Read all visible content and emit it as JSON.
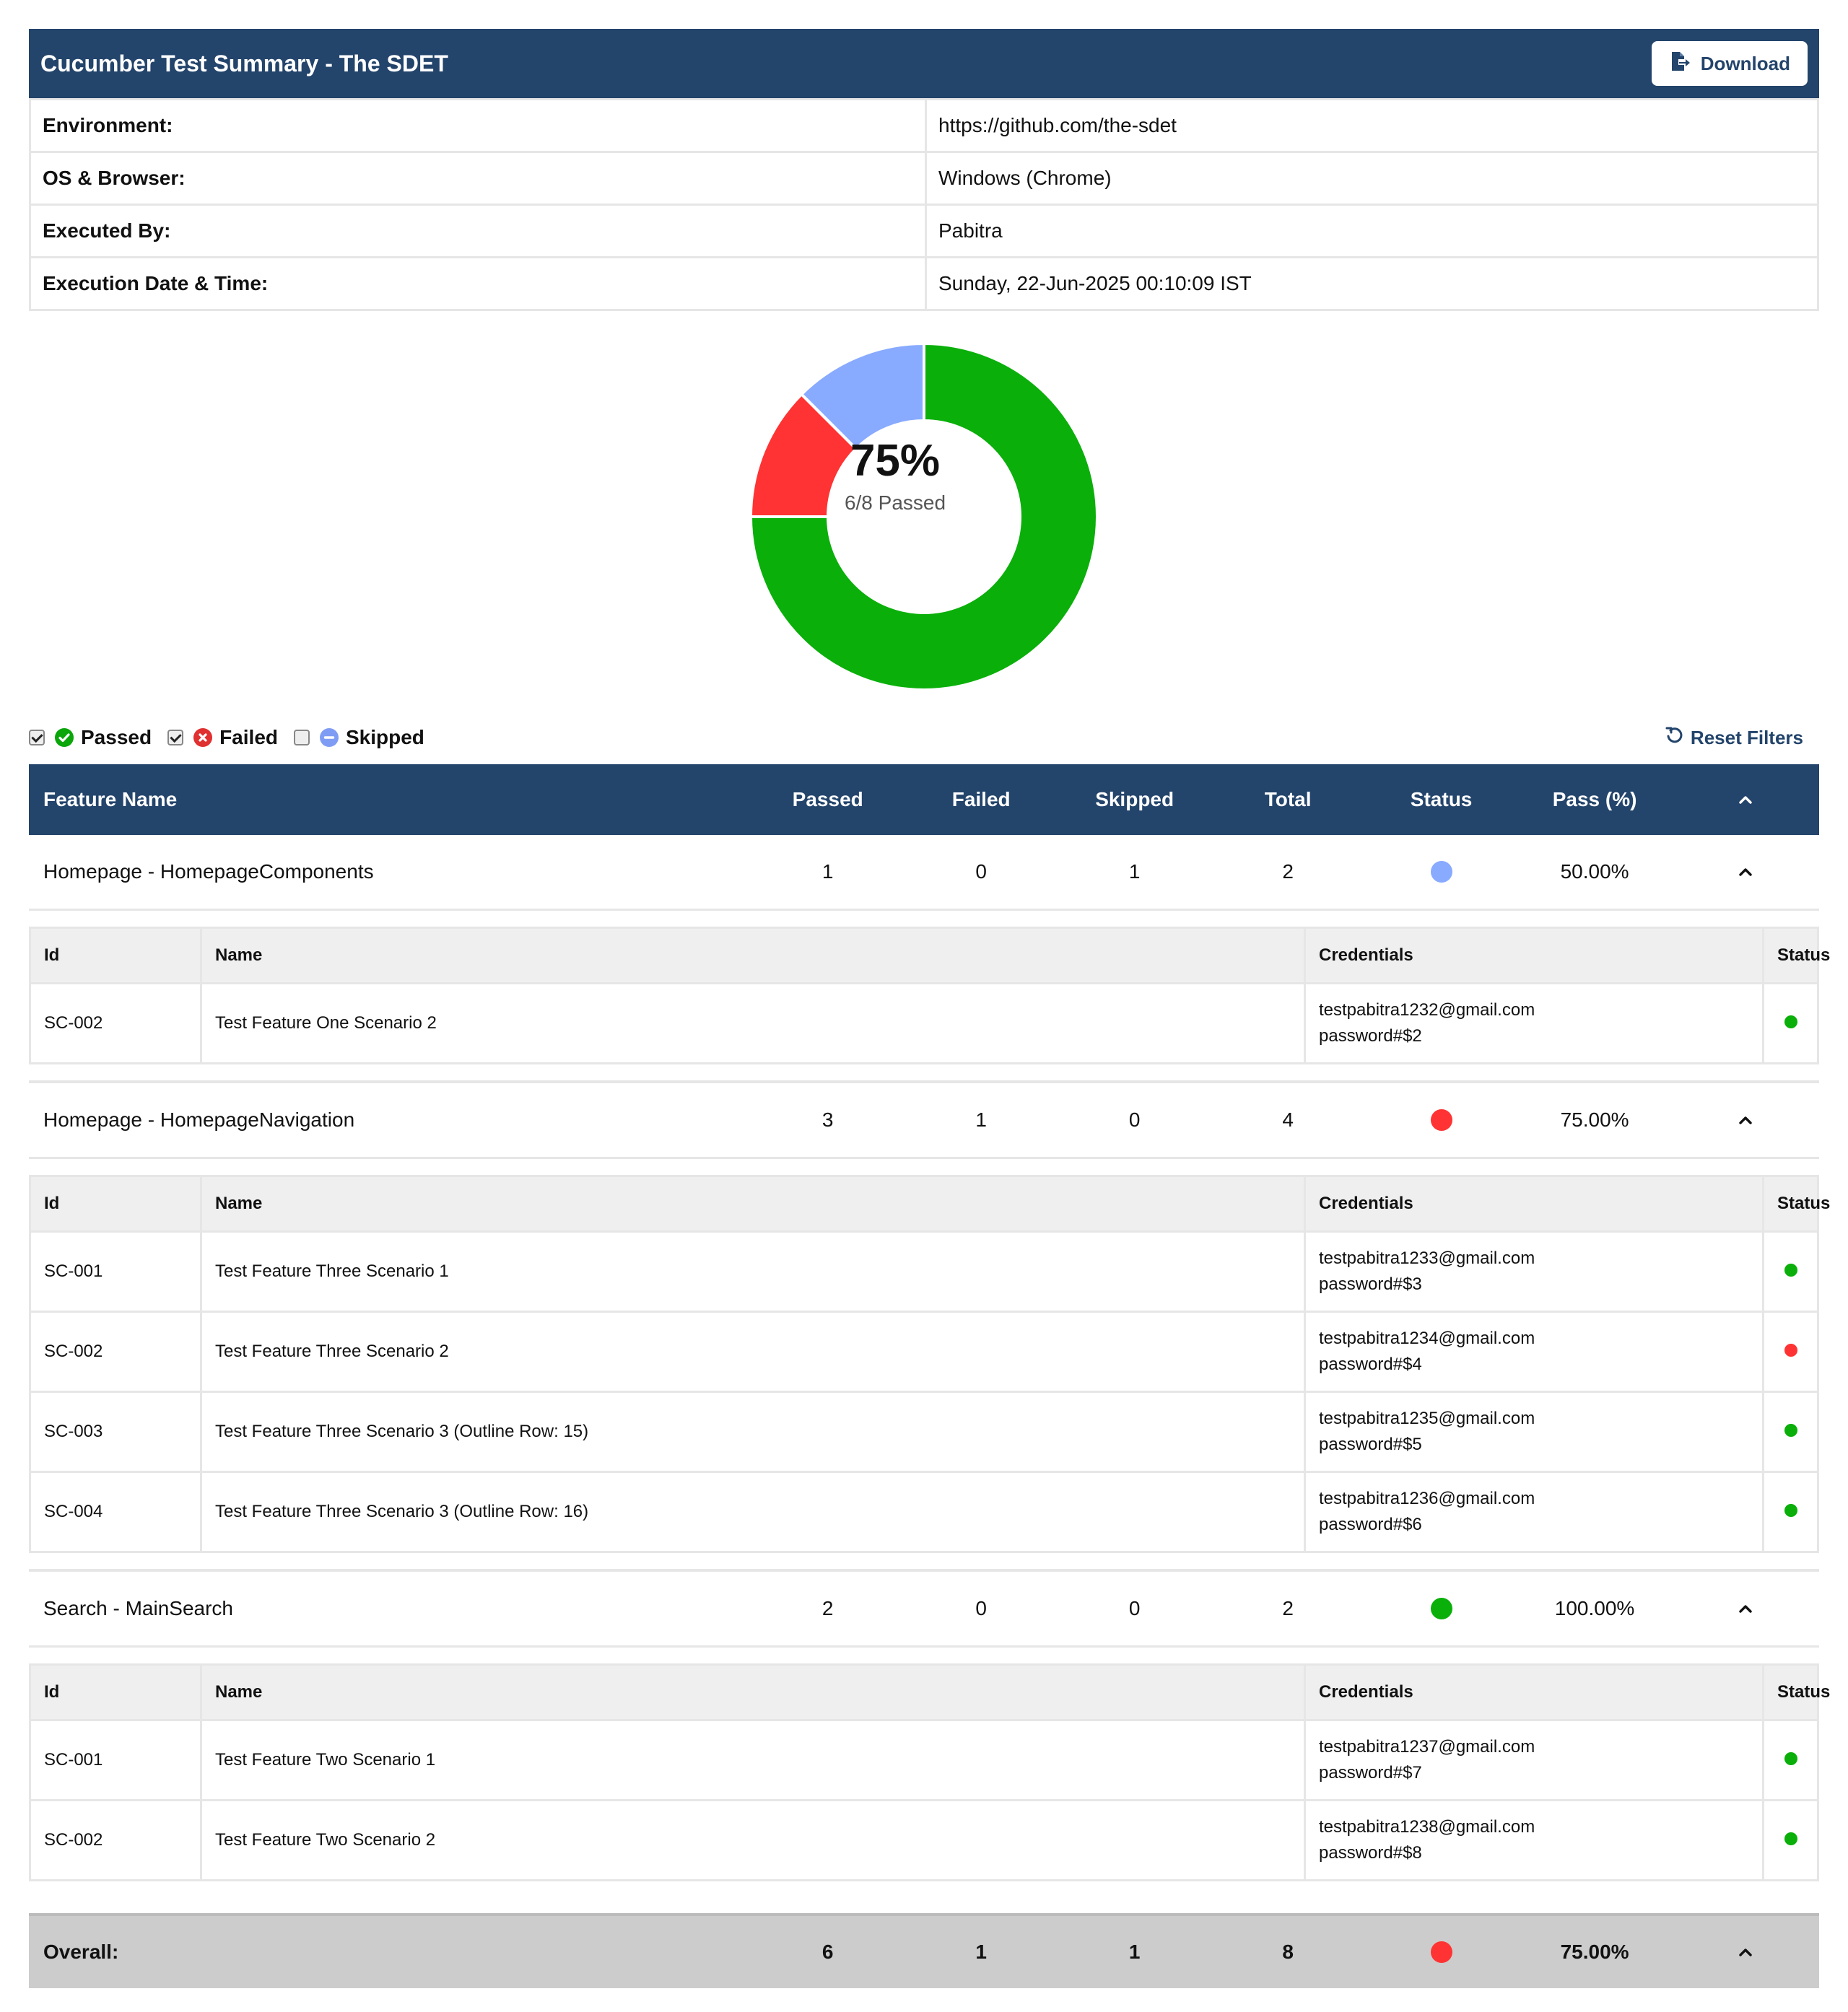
{
  "header": {
    "title": "Cucumber Test Summary - The SDET",
    "download_label": "Download"
  },
  "info": [
    {
      "key": "Environment:",
      "value": "https://github.com/the-sdet"
    },
    {
      "key": "OS & Browser:",
      "value": "Windows (Chrome)"
    },
    {
      "key": "Executed By:",
      "value": "Pabitra"
    },
    {
      "key": "Execution Date & Time:",
      "value": "Sunday, 22-Jun-2025 00:10:09 IST"
    }
  ],
  "chart_data": {
    "type": "pie",
    "donut": true,
    "categories": [
      "Passed",
      "Failed",
      "Skipped"
    ],
    "values": [
      6,
      1,
      1
    ],
    "colors": [
      "#0aaf0a",
      "#ff3333",
      "#88aaff"
    ],
    "center_value": "75%",
    "center_label": "6/8 Passed"
  },
  "filters": {
    "passed_label": "Passed",
    "failed_label": "Failed",
    "skipped_label": "Skipped",
    "passed_checked": true,
    "failed_checked": true,
    "skipped_checked": false,
    "reset_label": "Reset Filters"
  },
  "table": {
    "headers": {
      "feature": "Feature Name",
      "passed": "Passed",
      "failed": "Failed",
      "skipped": "Skipped",
      "total": "Total",
      "status": "Status",
      "pass_pct": "Pass (%)"
    },
    "scenario_headers": {
      "id": "Id",
      "name": "Name",
      "credentials": "Credentials",
      "status": "Status"
    }
  },
  "colors": {
    "passed": "#0aaf0a",
    "failed": "#ff3333",
    "skipped": "#88aaff",
    "header_bg": "#23446b"
  },
  "features": [
    {
      "name": "Homepage - HomepageComponents",
      "passed": "1",
      "failed": "0",
      "skipped": "1",
      "total": "2",
      "status": "skipped",
      "pass_pct": "50.00%",
      "scenarios": [
        {
          "id": "SC-002",
          "name": "Test Feature One Scenario 2",
          "email": "testpabitra1232@gmail.com",
          "password": "password#$2",
          "status": "passed"
        }
      ]
    },
    {
      "name": "Homepage - HomepageNavigation",
      "passed": "3",
      "failed": "1",
      "skipped": "0",
      "total": "4",
      "status": "failed",
      "pass_pct": "75.00%",
      "scenarios": [
        {
          "id": "SC-001",
          "name": "Test Feature Three Scenario 1",
          "email": "testpabitra1233@gmail.com",
          "password": "password#$3",
          "status": "passed"
        },
        {
          "id": "SC-002",
          "name": "Test Feature Three Scenario 2",
          "email": "testpabitra1234@gmail.com",
          "password": "password#$4",
          "status": "failed"
        },
        {
          "id": "SC-003",
          "name": "Test Feature Three Scenario 3 (Outline Row: 15)",
          "email": "testpabitra1235@gmail.com",
          "password": "password#$5",
          "status": "passed"
        },
        {
          "id": "SC-004",
          "name": "Test Feature Three Scenario 3 (Outline Row: 16)",
          "email": "testpabitra1236@gmail.com",
          "password": "password#$6",
          "status": "passed"
        }
      ]
    },
    {
      "name": "Search - MainSearch",
      "passed": "2",
      "failed": "0",
      "skipped": "0",
      "total": "2",
      "status": "passed",
      "pass_pct": "100.00%",
      "scenarios": [
        {
          "id": "SC-001",
          "name": "Test Feature Two Scenario 1",
          "email": "testpabitra1237@gmail.com",
          "password": "password#$7",
          "status": "passed"
        },
        {
          "id": "SC-002",
          "name": "Test Feature Two Scenario 2",
          "email": "testpabitra1238@gmail.com",
          "password": "password#$8",
          "status": "passed"
        }
      ]
    }
  ],
  "overall": {
    "label": "Overall:",
    "passed": "6",
    "failed": "1",
    "skipped": "1",
    "total": "8",
    "status": "failed",
    "pass_pct": "75.00%"
  }
}
